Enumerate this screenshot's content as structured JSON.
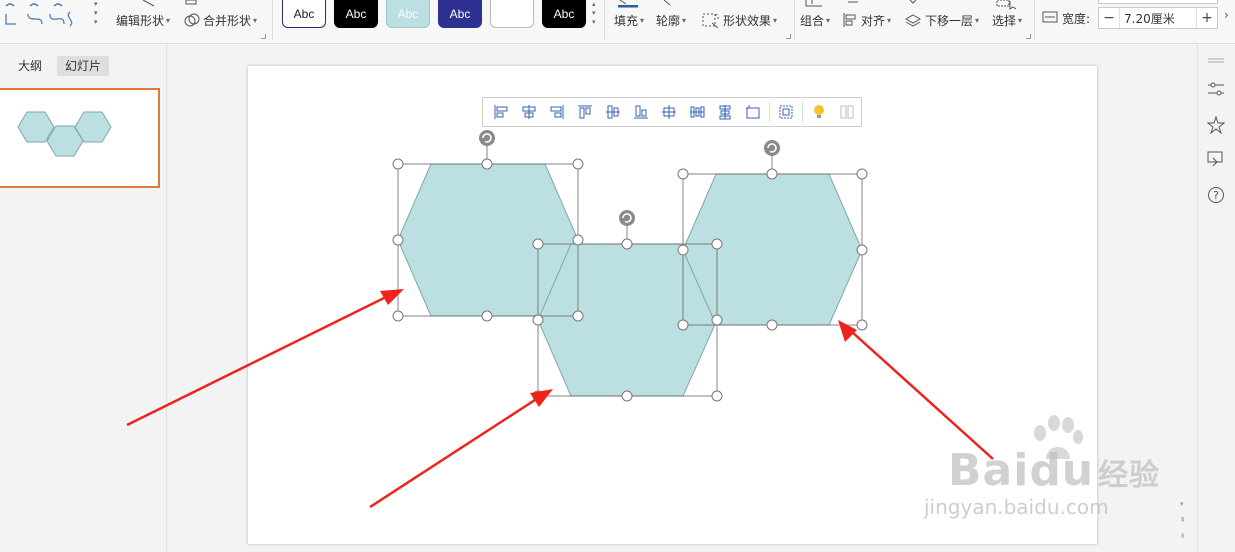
{
  "ribbon": {
    "edit_shape": "编辑形状",
    "merge_shape": "合并形状",
    "style_chips": [
      {
        "label": "Abc",
        "bg": "#ffffff",
        "fg": "#222222",
        "border": "#2a2a7a"
      },
      {
        "label": "Abc",
        "bg": "#000000",
        "fg": "#ffffff",
        "border": "#000000"
      },
      {
        "label": "Abc",
        "bg": "#bcdfe2",
        "fg": "#ffffff",
        "border": "#9ec8cc"
      },
      {
        "label": "Abc",
        "bg": "#2e3192",
        "fg": "#ffffff",
        "border": "#2e3192"
      },
      {
        "label": "",
        "bg": "#ffffff",
        "fg": "#222222",
        "border": "#bbbbbb"
      },
      {
        "label": "Abc",
        "bg": "#000000",
        "fg": "#ffffff",
        "border": "#000000"
      }
    ],
    "fill": "填充",
    "outline": "轮廓",
    "shape_effects": "形状效果",
    "group": "组合",
    "align": "对齐",
    "send_backward": "下移一层",
    "select": "选择",
    "width_label": "宽度:",
    "width_value": "7.20厘米",
    "minus": "−",
    "plus": "+"
  },
  "left_panel": {
    "tab_outline": "大纲",
    "tab_slides": "幻灯片"
  },
  "colors": {
    "hex_fill": "#bcdfe2",
    "hex_stroke": "#7fa7ab",
    "arrow": "#f0221c",
    "thumb_border": "#e07a3c"
  },
  "watermark": {
    "brand_a": "Bai",
    "brand_b": "du",
    "brand_c": "经验",
    "url": "jingyan.baidu.com"
  }
}
